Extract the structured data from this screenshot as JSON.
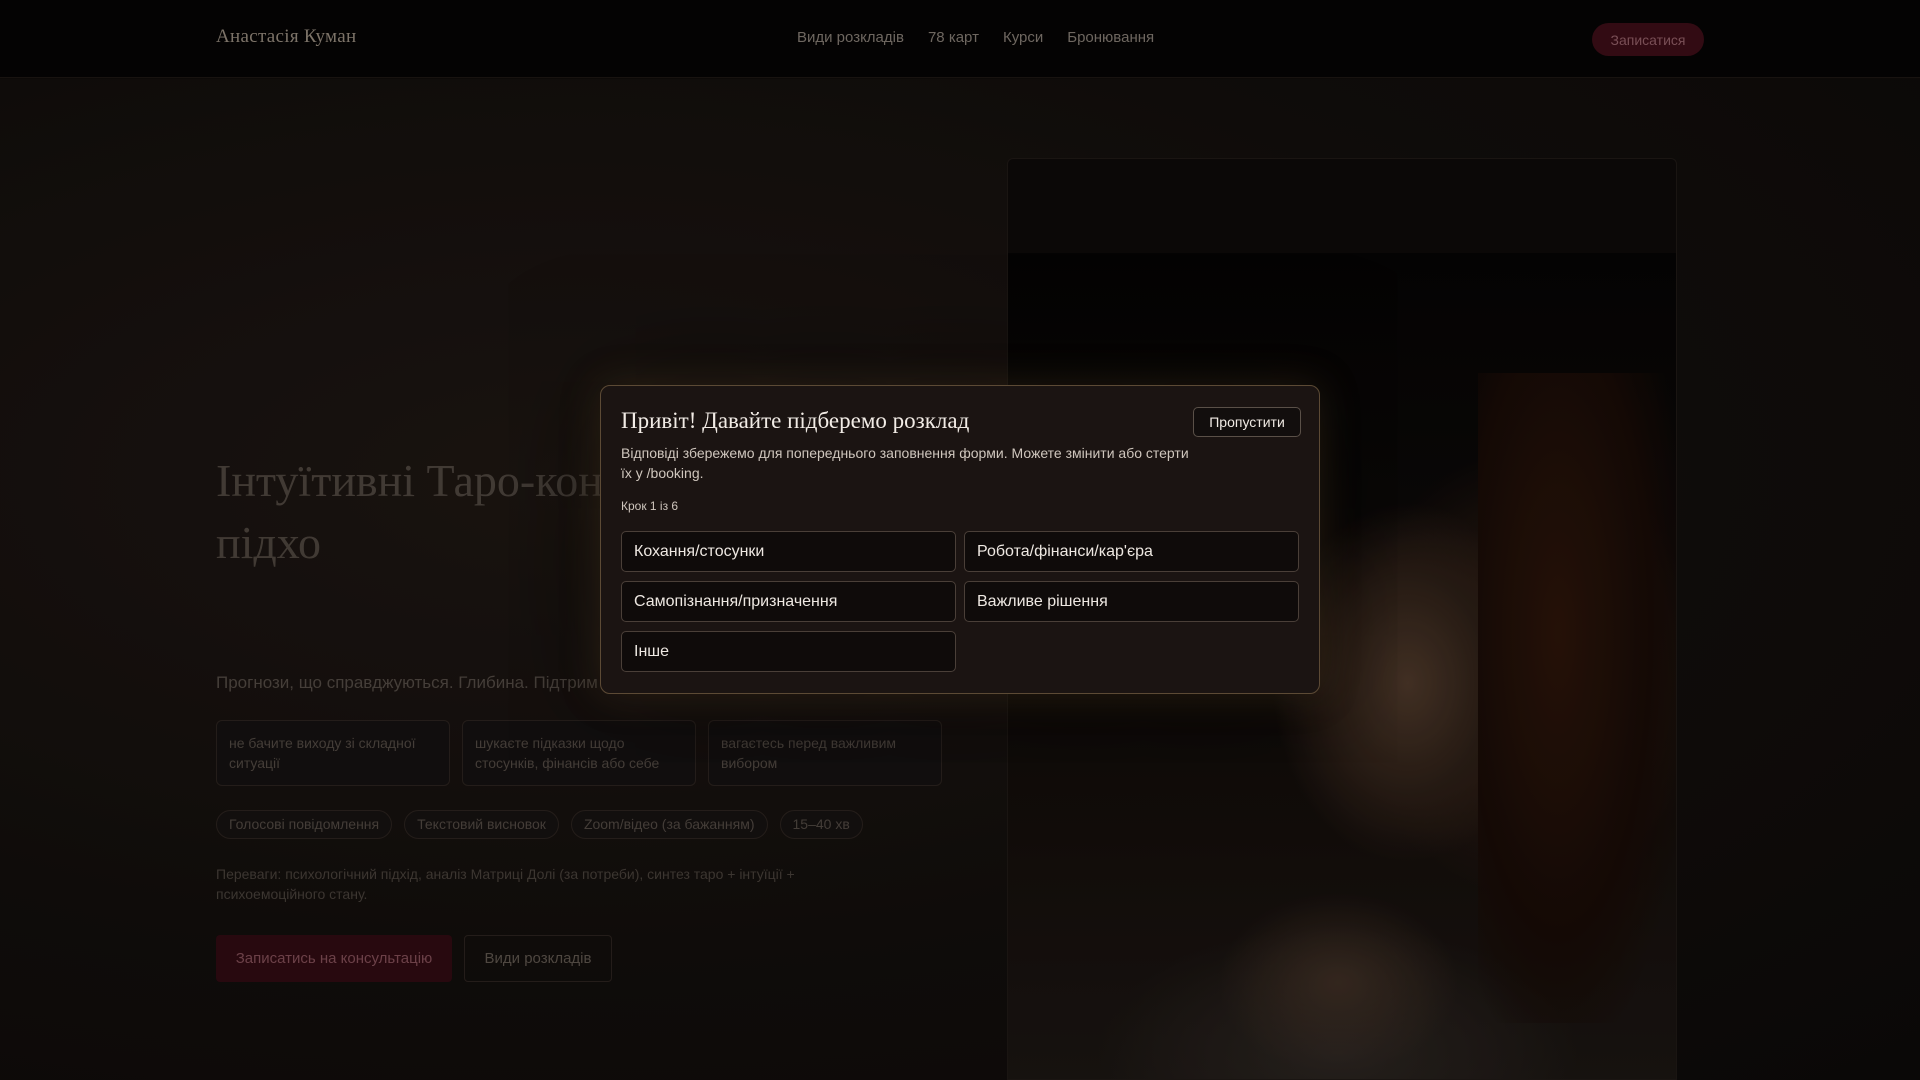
{
  "header": {
    "brand": "Анастасія Куман",
    "nav": [
      "Види розкладів",
      "78 карт",
      "Курси",
      "Бронювання"
    ],
    "cta": "Записатися"
  },
  "hero": {
    "title": "Інтуїтивні Таро-кон психологічним підхо",
    "subtitle": "Прогнози, що справджуються. Глибина. Підтрим",
    "pain_points": [
      "не бачите виходу зі складної ситуації",
      "шукаєте підказки щодо стосунків, фінансів або себе",
      "вагаєтесь перед важливим вибором"
    ],
    "features": [
      "Голосові повідомлення",
      "Текстовий висновок",
      "Zoom/відео (за бажанням)",
      "15–40 хв"
    ],
    "benefits": "Переваги: психологічний підхід, аналіз Матриці Долі (за потреби), синтез таро + інтуїції + психоемоційного стану.",
    "primary_button": "Записатись на консультацію",
    "secondary_button": "Види розкладів"
  },
  "modal": {
    "title": "Привіт! Давайте підберемо розклад",
    "description": "Відповіді збережемо для попереднього заповнення форми. Можете змінити або стерти їх у /booking.",
    "skip_label": "Пропустити",
    "step": "Крок 1 із 6",
    "options": [
      "Кохання/стосунки",
      "Робота/фінанси/кар'єра",
      "Самопізнання/призначення",
      "Важливе рішення",
      "Інше"
    ]
  }
}
